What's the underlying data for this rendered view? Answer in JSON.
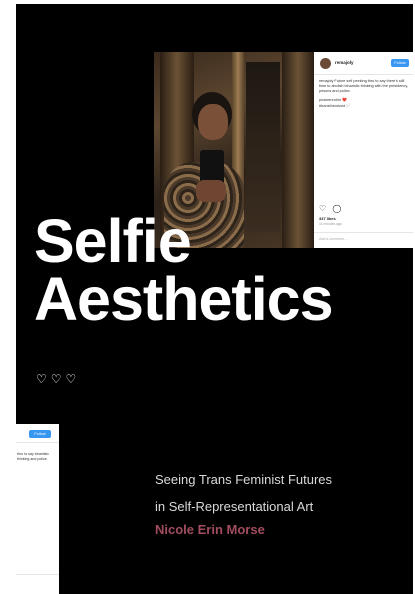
{
  "post_top": {
    "username": "remajoly",
    "follow_label": "Follow",
    "caption": "remajoly Future self peeking thru to say there's still time to abolish binaristic thinking with the presidency, prisons and police.",
    "tags": [
      "picturenrohin ❤️",
      "#transtheorized 🏳️"
    ],
    "actions_icons": "♡ ◯",
    "likes": "337 likes",
    "time": "11 minutes ago",
    "add_comment_placeholder": "Add a comment..."
  },
  "title": {
    "line1": "Selfie",
    "line2": "Aesthetics"
  },
  "hearts": "♡♡♡",
  "post_bottom": {
    "follow_label": "Follow",
    "caption": "thru to say binaristic thinking and police."
  },
  "subtitle": {
    "line1": "Seeing Trans Feminist Futures",
    "line2": "in Self-Representational Art"
  },
  "author": "Nicole Erin Morse",
  "colors": {
    "background": "#000000",
    "author_accent": "#a24d5f",
    "follow_button": "#3897f0"
  }
}
